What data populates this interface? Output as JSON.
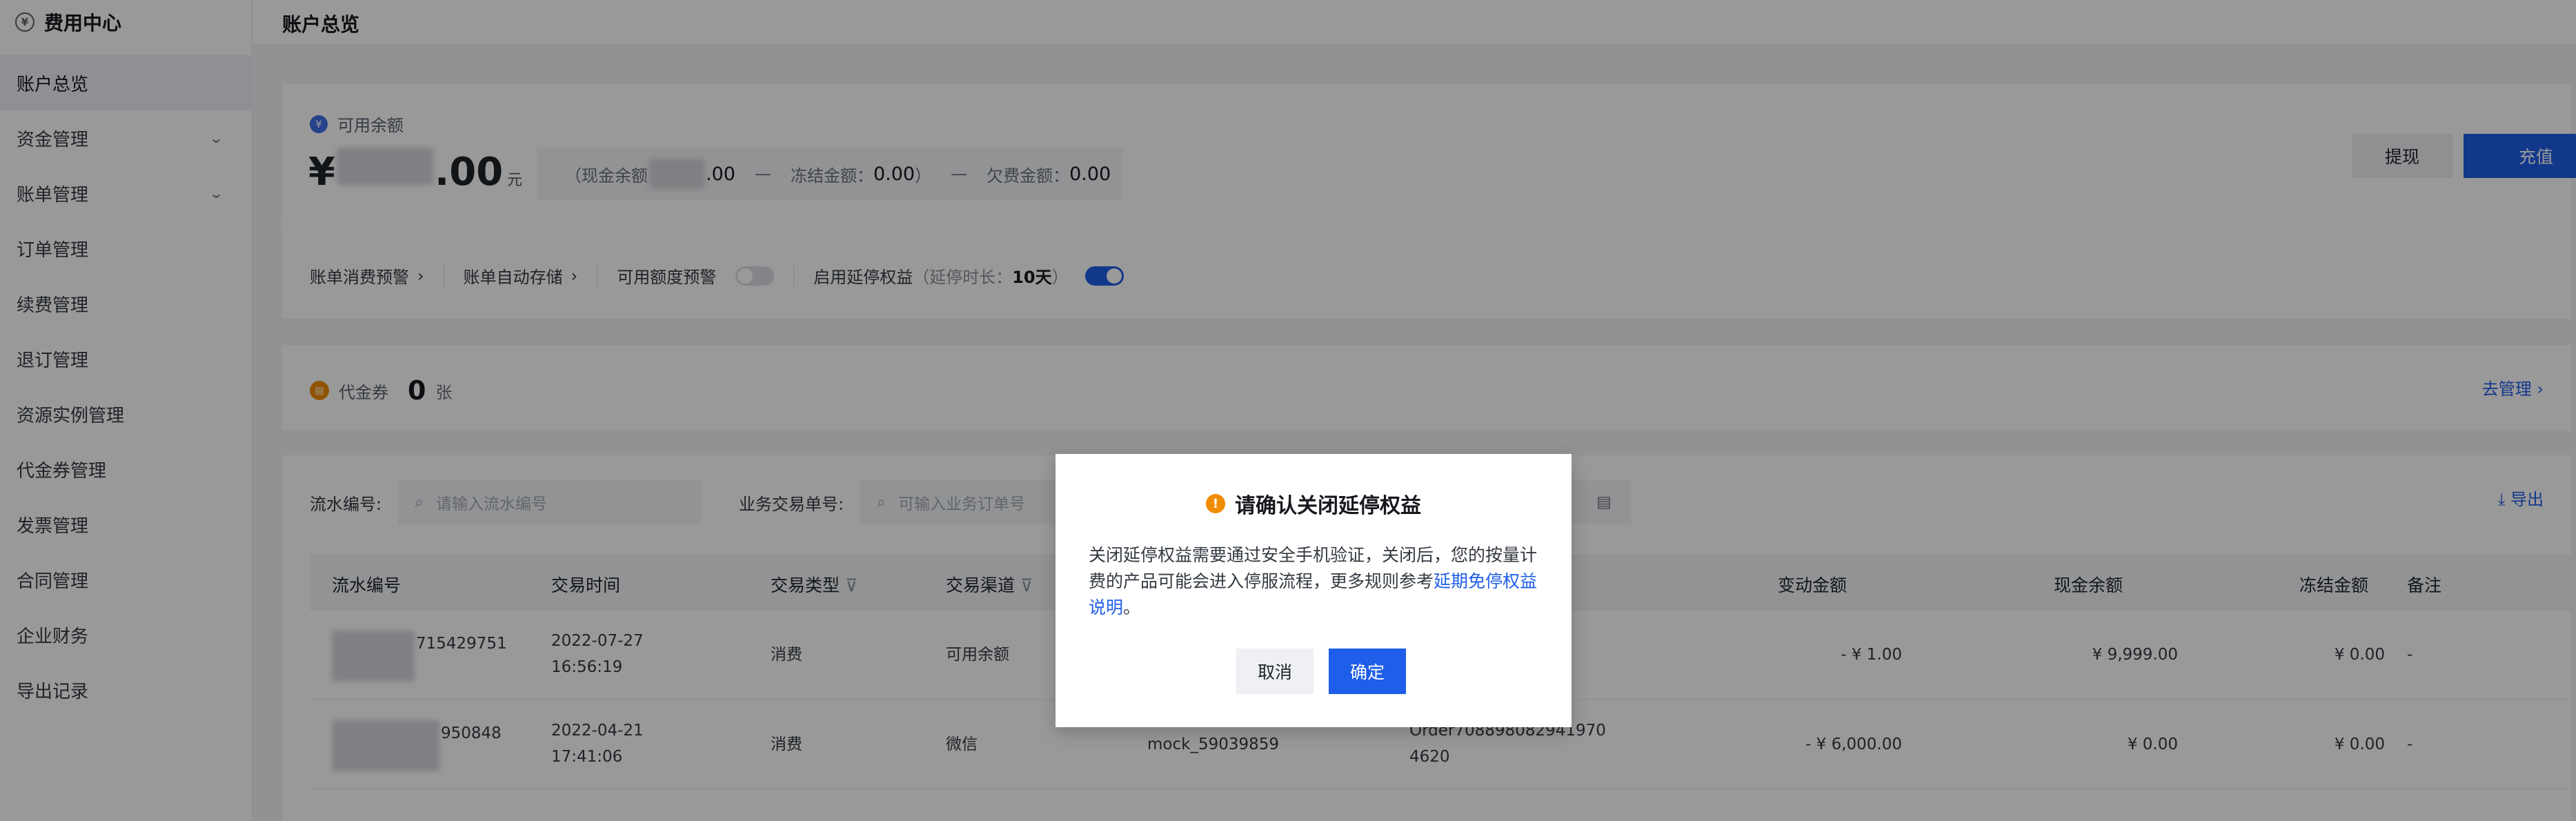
{
  "sidebar": {
    "title": "费用中心",
    "coin_glyph": "¥",
    "items": [
      {
        "label": "账户总览",
        "active": true
      },
      {
        "label": "资金管理",
        "expandable": true
      },
      {
        "label": "账单管理",
        "expandable": true
      },
      {
        "label": "订单管理"
      },
      {
        "label": "续费管理"
      },
      {
        "label": "退订管理"
      },
      {
        "label": "资源实例管理"
      },
      {
        "label": "代金券管理"
      },
      {
        "label": "发票管理"
      },
      {
        "label": "合同管理"
      },
      {
        "label": "企业财务"
      },
      {
        "label": "导出记录"
      }
    ]
  },
  "header": {
    "title": "账户总览"
  },
  "balance": {
    "label": "可用余额",
    "currency": "¥",
    "amount_visible": ".00",
    "unit": "元",
    "detail_open": "（现金余额",
    "cash_visible": ".00",
    "separator": "—",
    "frozen_label": "冻结金额：",
    "frozen_value": "0.00",
    "frozen_close": "）",
    "debt_label": "欠费金额：",
    "debt_value": "0.00",
    "withdraw_label": "提现",
    "recharge_label": "充值"
  },
  "options": {
    "bill_alert": "账单消费预警",
    "auto_store": "账单自动存储",
    "quota_alert": "可用额度预警",
    "quota_alert_on": false,
    "extend_label": "启用延停权益",
    "extend_note_prefix": "（延停时长：",
    "extend_days": "10天",
    "extend_note_suffix": "）",
    "extend_on": true,
    "chevron": "›"
  },
  "voucher": {
    "label": "代金券",
    "count": "0",
    "unit": "张",
    "manage": "去管理 ›"
  },
  "filters": {
    "serial_label": "流水编号:",
    "serial_placeholder": "请输入流水编号",
    "trade_label": "业务交易单号:",
    "trade_placeholder": "可输入业务订单号",
    "export": "导出"
  },
  "table": {
    "headers": {
      "serial": "流水编号",
      "time": "交易时间",
      "type": "交易类型",
      "channel": "交易渠道",
      "change": "变动金额",
      "cash": "现金余额",
      "frozen": "冻结金额",
      "remark": "备注"
    },
    "rows": [
      {
        "serial_tail": "715429751",
        "date": "2022-07-27",
        "time": "16:56:19",
        "type": "消费",
        "channel": "可用余额",
        "mock": "",
        "order_1": "",
        "order_2": "",
        "change": "- ¥ 1.00",
        "cash": "¥ 9,999.00",
        "frozen": "¥ 0.00",
        "remark": "-"
      },
      {
        "serial_tail": "950848",
        "date": "2022-04-21",
        "time": "17:41:06",
        "type": "消费",
        "channel": "微信",
        "mock": "mock_59039859",
        "order_1": "Order708898082941970",
        "order_2": "4620",
        "change": "- ¥ 6,000.00",
        "cash": "¥ 0.00",
        "frozen": "¥ 0.00",
        "remark": "-"
      }
    ]
  },
  "modal": {
    "title": "请确认关闭延停权益",
    "body": "关闭延停权益需要通过安全手机验证，关闭后，您的按量计费的产品可能会进入停服流程，更多规则参考",
    "link": "延期免停权益说明",
    "end": "。",
    "cancel": "取消",
    "ok": "确定"
  },
  "colors": {
    "accent": "#1e5ee8",
    "warning": "#f08c00"
  }
}
